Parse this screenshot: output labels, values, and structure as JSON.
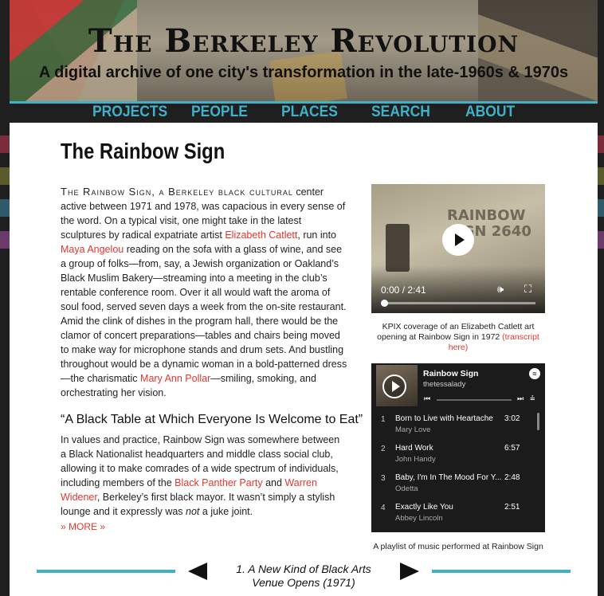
{
  "header": {
    "title": "The Berkeley Revolution",
    "subtitle": "A digital archive of one city's transformation in the late-1960s & 1970s"
  },
  "nav": [
    "PROJECTS",
    "PEOPLE",
    "PLACES",
    "SEARCH",
    "ABOUT"
  ],
  "page": {
    "title": "The Rainbow Sign",
    "intro_lead": "The Rainbow Sign, a Berkeley black cultural",
    "intro_1": "center active between 1971 and 1978, was capacious in every sense of the word. On a typical visit, one might take in the latest sculptures by radical expatriate artist ",
    "link_catlett": "Elizabeth Catlett",
    "intro_2": ", run into ",
    "link_angelou": "Maya Angelou",
    "intro_3": " reading on the sofa with a glass of wine, and see a group of folks—from, say, a Jewish organization or Oakland’s Black Muslim Bakery—streaming into a meeting in the club’s rentable conference room. Over it all would waft the aroma of soul food, served seven days a week from the on-site restaurant. Amid the clink of dishes in the program hall, there would be the clamor of concert preparations—tables and chairs being moved to make way for microphone stands and drum sets. And bustling throughout would be a dynamic woman in a bold-patterned dress—the charismatic ",
    "link_pollar": "Mary Ann Pollar",
    "intro_4": "—smiling, smoking, and orchestrating her vision.",
    "section_heading": "“A Black Table at Which Everyone Is Welcome to Eat”",
    "sec_1": "In values and practice, Rainbow Sign was somewhere between a Black Nationalist headquarters and middle class social club, allowing it to make comrades of a wide spectrum of individuals, including members of the ",
    "link_panther": "Black Panther Party",
    "sec_2": " and ",
    "link_widener": "Warren Widener",
    "sec_3": ", Berkeley’s first black mayor. It wasn’t simply a stylish lounge and it expressly was ",
    "sec_em": "not",
    "sec_4": " a juke joint.",
    "more": "» MORE »"
  },
  "video": {
    "time": "0:00 / 2:41",
    "sign_text": "RAINBOW SIGN 2640",
    "progress": 0.0,
    "caption_1": "KPIX coverage of an Elizabeth Catlett art opening at Rainbow Sign in 1972 ",
    "caption_link": "(transcript here)"
  },
  "playlist": {
    "title": "Rainbow Sign",
    "owner": "thetessalady",
    "tracks": [
      {
        "num": "1",
        "song": "Born to Live with Heartache",
        "artist": "Mary Love",
        "dur": "3:02"
      },
      {
        "num": "2",
        "song": "Hard Work",
        "artist": "John Handy",
        "dur": "6:57"
      },
      {
        "num": "3",
        "song": "Baby, I'm In The Mood For Y...",
        "artist": "Odetta",
        "dur": "2:48"
      },
      {
        "num": "4",
        "song": "Exactly Like You",
        "artist": "Abbey Lincoln",
        "dur": "2:51"
      }
    ],
    "caption": "A playlist of music performed at Rainbow Sign"
  },
  "pager": {
    "text": "1. A New Kind of Black Arts Venue Opens (1971)"
  },
  "colors": {
    "accent": "#3fb1c9",
    "link": "#e2372e",
    "background": "#1f1f1f"
  }
}
